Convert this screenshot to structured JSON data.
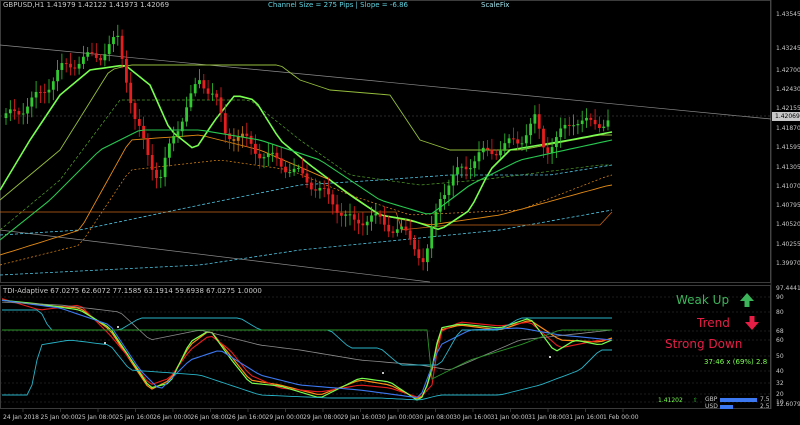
{
  "symbol_header": "GBPUSD,H1  1.41979 1.42122 1.41973 1.42069",
  "channel_info": "Channel Size = 275 Pips  |  Slope = -6.86",
  "scalefix_label": "ScaleFix",
  "indicator_header": "TDI-Adaptive 67.0275 62.6072 77.1585 63.1914 59.6938 67.0275 1.0000",
  "current_price_badge": "1.42069",
  "sub_top_badge": "97.4441",
  "sub_bottom_badge": "12.6079",
  "price_axis": [
    "1.43545",
    "1.43245",
    "1.42700",
    "1.42430",
    "1.42155",
    "1.41870",
    "1.41595",
    "1.41305",
    "1.41070",
    "1.40795",
    "1.40520",
    "1.40255",
    "1.39970"
  ],
  "sub_axis": [
    "90",
    "80",
    "68",
    "60",
    "50",
    "40",
    "32",
    "20",
    "10"
  ],
  "time_axis": [
    "24 Jan 2018",
    "25 Jan 00:00",
    "25 Jan 08:00",
    "25 Jan 16:00",
    "26 Jan 00:00",
    "26 Jan 08:00",
    "26 Jan 16:00",
    "29 Jan 00:00",
    "29 Jan 08:00",
    "29 Jan 16:00",
    "30 Jan 00:00",
    "30 Jan 08:00",
    "30 Jan 16:00",
    "31 Jan 00:00",
    "31 Jan 08:00",
    "31 Jan 16:00",
    "1 Feb 00:00"
  ],
  "signals": {
    "weak_up": "Weak Up",
    "trend": "Trend",
    "strong_down": "Strong Down",
    "weak_up_color": "#3cb45a",
    "trend_color": "#e61e46",
    "strong_down_color": "#e61e46"
  },
  "timer": "37:46 x (69%) 2.8",
  "price_readout": "1.41202",
  "price_readout_icon": "up-arrow-icon",
  "currency_strength": [
    {
      "currency": "GBP",
      "value": "7.5",
      "strength": 0.75
    },
    {
      "currency": "USD",
      "value": "2.5",
      "strength": 0.25
    }
  ],
  "colors": {
    "bull_candle": "#32c832",
    "bear_candle": "#e61e1e",
    "neutral_candle": "#c87814",
    "fast_ma": "#78ff50",
    "channel_line": "#8c8c8c",
    "band_outer": "#e68c14",
    "band_mid": "#50c8e6",
    "tdi_price": "#ff8c14",
    "tdi_signal": "#e61e1e",
    "tdi_green": "#78ff50",
    "tdi_blue": "#3c78f0",
    "tdi_band": "#28b4c8"
  }
}
